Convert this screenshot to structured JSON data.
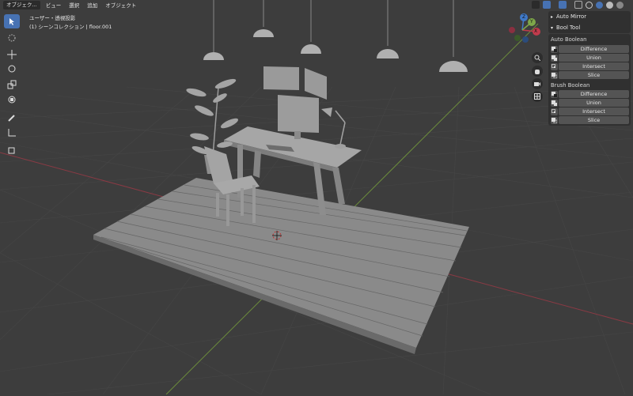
{
  "header": {
    "mode_label": "オブジェク...",
    "menus": [
      "ビュー",
      "選択",
      "追加",
      "オブジェクト"
    ]
  },
  "overlay": {
    "view_label": "ユーザー・透視投影",
    "collection_label": "(1) シーンコレクション | floor.001"
  },
  "sidebar": {
    "auto_mirror": "Auto Mirror",
    "bool_tool": "Bool Tool",
    "auto_boolean_title": "Auto Boolean",
    "auto_boolean_buttons": [
      "Difference",
      "Union",
      "Intersect",
      "Slice"
    ],
    "brush_boolean_title": "Brush Boolean",
    "brush_boolean_buttons": [
      "Difference",
      "Union",
      "Intersect",
      "Slice"
    ]
  },
  "gizmo": {
    "x": "X",
    "y": "Y",
    "z": "Z"
  },
  "colors": {
    "accent": "#4772b3",
    "x_axis": "#c13b4c",
    "y_axis": "#7ea84a",
    "z_axis": "#3f79c8"
  }
}
